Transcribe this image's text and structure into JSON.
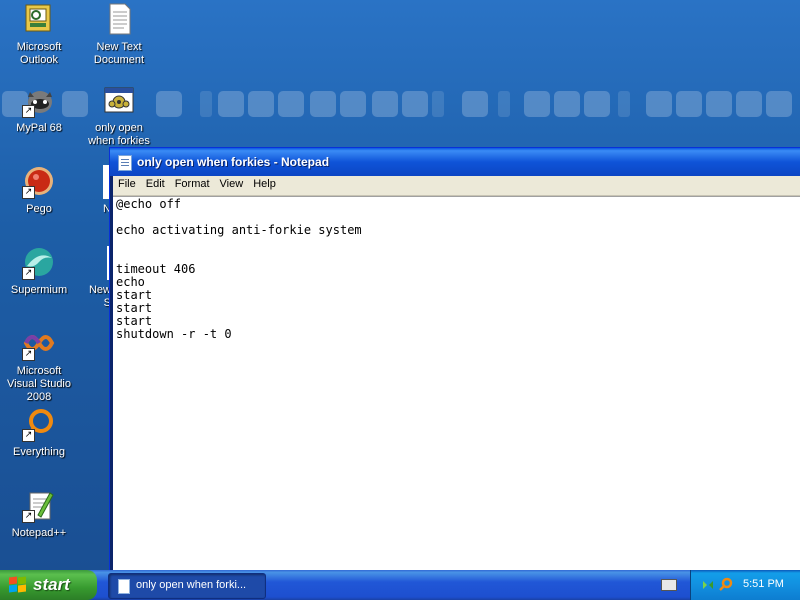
{
  "desktop": {
    "icons": [
      {
        "label": "Microsoft Outlook",
        "icon": "outlook-icon"
      },
      {
        "label": "New Text Document",
        "icon": "text-document-icon"
      },
      {
        "label": "MyPal 68",
        "icon": "mypal-icon"
      },
      {
        "label": "only open when forkies",
        "icon": "batch-file-icon"
      },
      {
        "label": "Pego",
        "icon": "pego-icon"
      },
      {
        "label": "N",
        "icon": "partial-icon"
      },
      {
        "label": "Supermium",
        "icon": "supermium-icon"
      },
      {
        "label": "New S",
        "icon": "partial-icon"
      },
      {
        "label": "Microsoft Visual Studio 2008",
        "icon": "visual-studio-icon"
      },
      {
        "label": "Everything",
        "icon": "everything-icon"
      },
      {
        "label": "Notepad++",
        "icon": "notepadpp-icon"
      }
    ]
  },
  "window": {
    "title": "only open when forkies - Notepad",
    "menu": [
      "File",
      "Edit",
      "Format",
      "View",
      "Help"
    ],
    "content": "@echo off\n\necho activating anti-forkie system\n\n\ntimeout 406\necho\nstart\nstart\nstart\nshutdown -r -t 0"
  },
  "taskbar": {
    "start_label": "start",
    "task_label": "only open when forki...",
    "clock": "5:51 PM"
  },
  "colors": {
    "desktop": "#1f5fa8",
    "titlebar": "#0b46c4",
    "taskbar": "#2157d7",
    "start_button": "#379a2f",
    "tray": "#1290e0"
  }
}
